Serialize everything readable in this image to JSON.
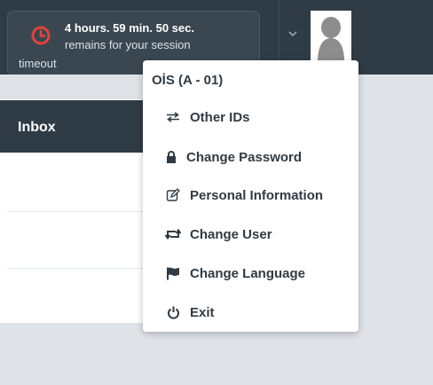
{
  "session": {
    "line1": "4 hours. 59 min. 50 sec.",
    "line2": "remains for your session",
    "line3": "timeout"
  },
  "panel": {
    "title": "Inbox"
  },
  "menu": {
    "header": "OİS (A - 01)",
    "items": [
      {
        "label": "Other IDs",
        "icon": "swap-arrows-icon"
      },
      {
        "label": "Change Password",
        "icon": "lock-icon"
      },
      {
        "label": "Personal Information",
        "icon": "edit-icon"
      },
      {
        "label": "Change User",
        "icon": "retweet-icon"
      },
      {
        "label": "Change Language",
        "icon": "flag-icon"
      },
      {
        "label": "Exit",
        "icon": "power-icon"
      }
    ]
  },
  "colors": {
    "topbar": "#2f3b45",
    "clock_icon": "#e2433b",
    "menu_text": "#2f3b45"
  }
}
